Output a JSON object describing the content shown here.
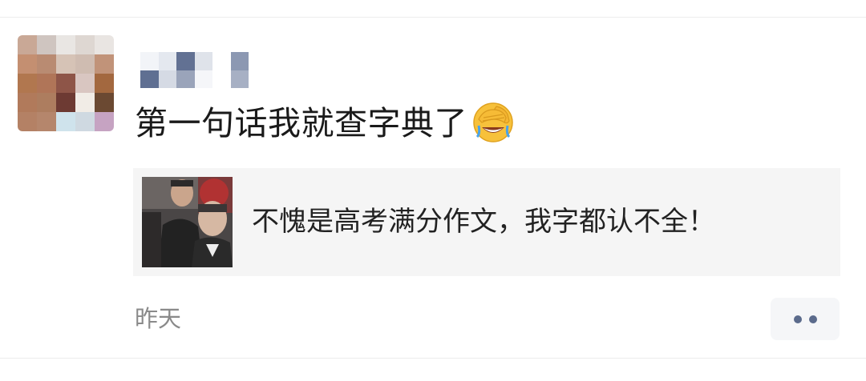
{
  "post": {
    "text": "第一句话我就查字典了",
    "emoji": "facepalm-emoji",
    "share_card": {
      "text": "不愧是高考满分作文，我字都认不全！",
      "thumbnail": "people-photo"
    },
    "time": "昨天",
    "more_icon": "more-dots-icon"
  },
  "colors": {
    "accent": "#5b6b8c",
    "card_bg": "#f5f5f5",
    "time_text": "#8a8a8a"
  }
}
